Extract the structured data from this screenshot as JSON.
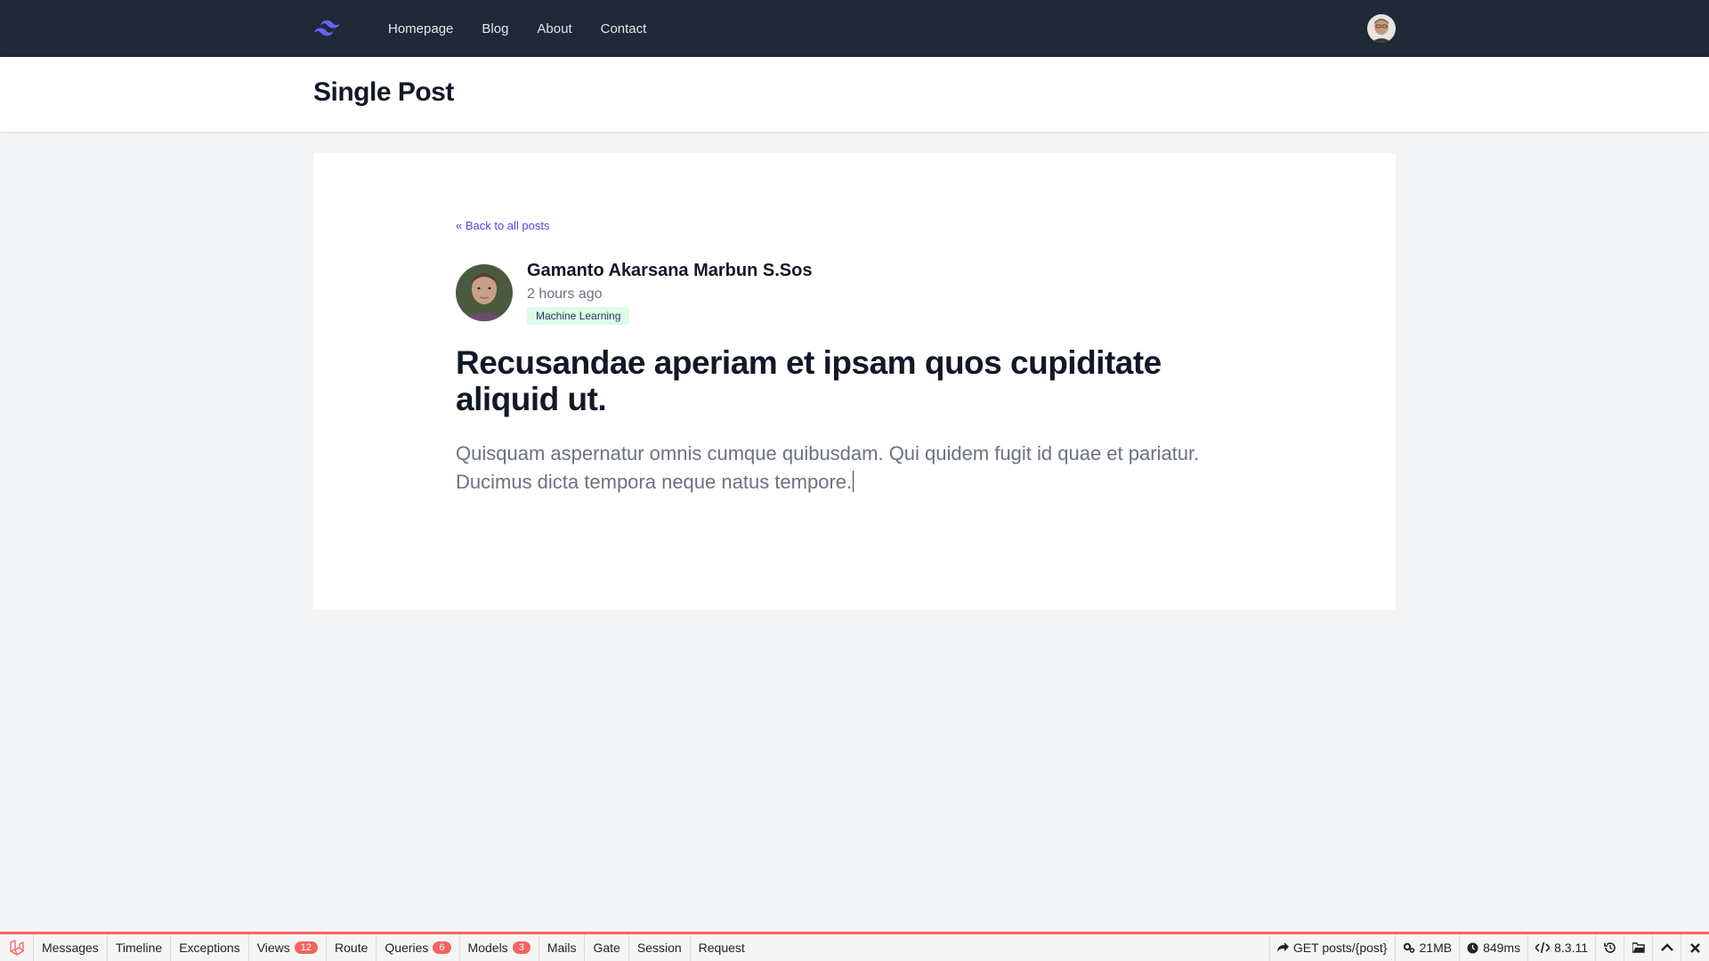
{
  "nav": {
    "links": [
      {
        "label": "Homepage"
      },
      {
        "label": "Blog"
      },
      {
        "label": "About"
      },
      {
        "label": "Contact"
      }
    ]
  },
  "header": {
    "title": "Single Post"
  },
  "post": {
    "back_link": "« Back to all posts",
    "author": "Gamanto Akarsana Marbun S.Sos",
    "time": "2 hours ago",
    "category": "Machine Learning",
    "title": "Recusandae aperiam et ipsam quos cupiditate aliquid ut.",
    "body": "Quisquam aspernatur omnis cumque quibusdam. Qui quidem fugit id quae et pariatur. Ducimus dicta tempora neque natus tempore."
  },
  "debugbar": {
    "tabs": [
      {
        "label": "Messages",
        "badge": ""
      },
      {
        "label": "Timeline",
        "badge": ""
      },
      {
        "label": "Exceptions",
        "badge": ""
      },
      {
        "label": "Views",
        "badge": "12"
      },
      {
        "label": "Route",
        "badge": ""
      },
      {
        "label": "Queries",
        "badge": "6"
      },
      {
        "label": "Models",
        "badge": "3"
      },
      {
        "label": "Mails",
        "badge": ""
      },
      {
        "label": "Gate",
        "badge": ""
      },
      {
        "label": "Session",
        "badge": ""
      },
      {
        "label": "Request",
        "badge": ""
      }
    ],
    "route": "GET posts/{post}",
    "memory": "21MB",
    "time": "849ms",
    "version": "8.3.11"
  },
  "colors": {
    "nav_bg": "#1f2937",
    "accent": "#4f46e5",
    "debug_accent": "#f4645f",
    "tag_bg": "#dcfce7"
  },
  "icons": [
    "tailwind-logo-icon",
    "laravel-icon",
    "share-icon",
    "cogs-icon",
    "clock-icon",
    "code-icon",
    "history-icon",
    "folder-icon",
    "chevron-up-icon",
    "close-icon"
  ]
}
